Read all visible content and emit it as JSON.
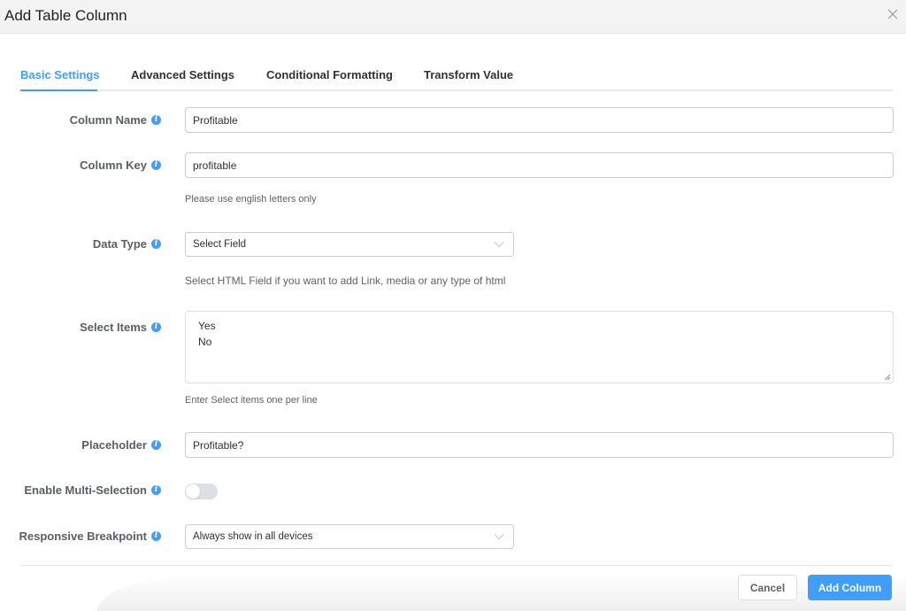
{
  "modal": {
    "title": "Add Table Column",
    "close_icon": "close-icon"
  },
  "tabs": [
    {
      "label": "Basic Settings",
      "active": true
    },
    {
      "label": "Advanced Settings",
      "active": false
    },
    {
      "label": "Conditional Formatting",
      "active": false
    },
    {
      "label": "Transform Value",
      "active": false
    }
  ],
  "form": {
    "column_name": {
      "label": "Column Name",
      "value": "Profitable"
    },
    "column_key": {
      "label": "Column Key",
      "value": "profitable",
      "help": "Please use english letters only"
    },
    "data_type": {
      "label": "Data Type",
      "selected": "Select Field",
      "help": "Select HTML Field if you want to add Link, media or any type of html"
    },
    "select_items": {
      "label": "Select Items",
      "lines": [
        "Yes",
        "No"
      ],
      "help": "Enter Select items one per line"
    },
    "placeholder": {
      "label": "Placeholder",
      "value": "Profitable?"
    },
    "multi_selection": {
      "label": "Enable Multi-Selection",
      "enabled": false
    },
    "responsive_breakpoint": {
      "label": "Responsive Breakpoint",
      "selected": "Always show in all devices"
    }
  },
  "footer": {
    "cancel_label": "Cancel",
    "submit_label": "Add Column"
  },
  "colors": {
    "accent": "#409eff",
    "label": "#5a5e66",
    "toggle_off": "#dcdfe6"
  },
  "icons": {
    "info": "info-icon",
    "chevron": "chevron-down-icon",
    "resize": "resize-grip-icon"
  }
}
